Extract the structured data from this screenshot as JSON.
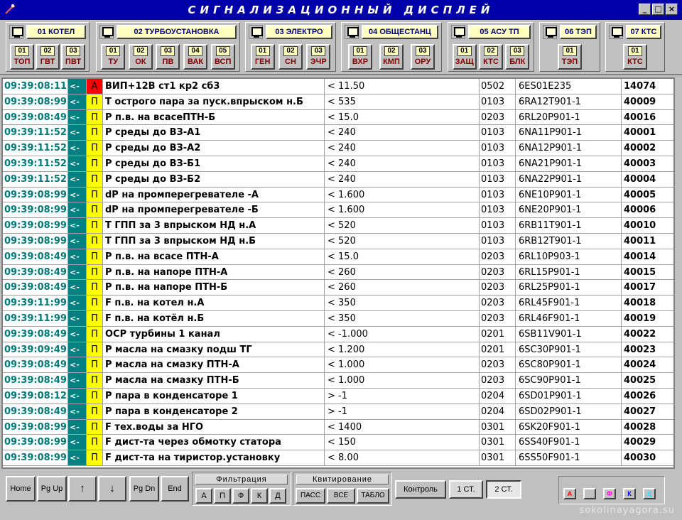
{
  "window": {
    "title": "СИГНАЛИЗАЦИОННЫЙ   ДИСПЛЕЙ",
    "min": "_",
    "max": "□",
    "close": "×"
  },
  "groups": [
    {
      "title": "01 КОТЕЛ",
      "buttons": [
        {
          "num": "01",
          "code": "ТОП"
        },
        {
          "num": "02",
          "code": "ГВТ"
        },
        {
          "num": "03",
          "code": "ПВТ"
        }
      ]
    },
    {
      "title": "02 ТУРБОУСТАНОВКА",
      "buttons": [
        {
          "num": "01",
          "code": "ТУ"
        },
        {
          "num": "02",
          "code": "ОК"
        },
        {
          "num": "03",
          "code": "ПВ"
        },
        {
          "num": "04",
          "code": "ВАК"
        },
        {
          "num": "05",
          "code": "ВСП"
        }
      ]
    },
    {
      "title": "03 ЭЛЕКТРО",
      "buttons": [
        {
          "num": "01",
          "code": "ГЕН"
        },
        {
          "num": "02",
          "code": "СН"
        },
        {
          "num": "03",
          "code": "ЭЧР"
        }
      ]
    },
    {
      "title": "04 ОБЩЕСТАНЦ",
      "buttons": [
        {
          "num": "01",
          "code": "ВХР"
        },
        {
          "num": "02",
          "code": "КМП"
        },
        {
          "num": "03",
          "code": "ОРУ"
        }
      ]
    },
    {
      "title": "05 АСУ ТП",
      "buttons": [
        {
          "num": "01",
          "code": "ЗАЩ"
        },
        {
          "num": "02",
          "code": "КТС"
        },
        {
          "num": "03",
          "code": "БЛК"
        }
      ]
    },
    {
      "title": "06 ТЭП",
      "buttons": [
        {
          "num": "01",
          "code": "ТЭП"
        }
      ]
    },
    {
      "title": "07 КТС",
      "buttons": [
        {
          "num": "01",
          "code": "КТС"
        }
      ]
    }
  ],
  "rows": [
    {
      "time": "09:39:08:11",
      "dir": "<-",
      "type": "А",
      "alarm": true,
      "name": "ВИП+12В ст1 кр2 сб3",
      "value": "<  11.50",
      "code": "0502",
      "kks": "6ES01E235",
      "id": "14074"
    },
    {
      "time": "09:39:08:99",
      "dir": "<-",
      "type": "П",
      "name": "Т острого пара за пуск.впрыском н.Б",
      "value": "<  535",
      "code": "0103",
      "kks": "6RA12T901-1",
      "id": "40009"
    },
    {
      "time": "09:39:08:49",
      "dir": "<-",
      "type": "П",
      "name": "Р п.в. на всасеПТН-Б",
      "value": "<  15.0",
      "code": "0203",
      "kks": "6RL20P901-1",
      "id": "40016"
    },
    {
      "time": "09:39:11:52",
      "dir": "<-",
      "type": "П",
      "name": "Р среды до ВЗ-А1",
      "value": "<  240",
      "code": "0103",
      "kks": "6NA11P901-1",
      "id": "40001"
    },
    {
      "time": "09:39:11:52",
      "dir": "<-",
      "type": "П",
      "name": "Р среды до ВЗ-А2",
      "value": "<  240",
      "code": "0103",
      "kks": "6NA12P901-1",
      "id": "40002"
    },
    {
      "time": "09:39:11:52",
      "dir": "<-",
      "type": "П",
      "name": "Р среды до ВЗ-Б1",
      "value": "<  240",
      "code": "0103",
      "kks": "6NA21P901-1",
      "id": "40003"
    },
    {
      "time": "09:39:11:52",
      "dir": "<-",
      "type": "П",
      "name": "Р среды до ВЗ-Б2",
      "value": "<  240",
      "code": "0103",
      "kks": "6NA22P901-1",
      "id": "40004"
    },
    {
      "time": "09:39:08:99",
      "dir": "<-",
      "type": "П",
      "name": "dP на промперегревателе -А",
      "value": "<  1.600",
      "code": "0103",
      "kks": "6NE10P901-1",
      "id": "40005"
    },
    {
      "time": "09:39:08:99",
      "dir": "<-",
      "type": "П",
      "name": "dP на промперегревателе -Б",
      "value": "<  1.600",
      "code": "0103",
      "kks": "6NE20P901-1",
      "id": "40006"
    },
    {
      "time": "09:39:08:99",
      "dir": "<-",
      "type": "П",
      "name": "Т ГПП за 3 впрыском НД н.А",
      "value": "<  520",
      "code": "0103",
      "kks": "6RB11T901-1",
      "id": "40010"
    },
    {
      "time": "09:39:08:99",
      "dir": "<-",
      "type": "П",
      "name": "Т ГПП за 3 впрыском НД н.Б",
      "value": "<  520",
      "code": "0103",
      "kks": "6RB12T901-1",
      "id": "40011"
    },
    {
      "time": "09:39:08:49",
      "dir": "<-",
      "type": "П",
      "name": "Р п.в. на всасе ПТН-А",
      "value": "<  15.0",
      "code": "0203",
      "kks": "6RL10P903-1",
      "id": "40014"
    },
    {
      "time": "09:39:08:49",
      "dir": "<-",
      "type": "П",
      "name": "Р п.в. на напоре ПТН-А",
      "value": "<  260",
      "code": "0203",
      "kks": "6RL15P901-1",
      "id": "40015"
    },
    {
      "time": "09:39:08:49",
      "dir": "<-",
      "type": "П",
      "name": "Р п.в. на напоре  ПТН-Б",
      "value": "<  260",
      "code": "0203",
      "kks": "6RL25P901-1",
      "id": "40017"
    },
    {
      "time": "09:39:11:99",
      "dir": "<-",
      "type": "П",
      "name": "F п.в. на котел н.А",
      "value": "<   350",
      "code": "0203",
      "kks": "6RL45F901-1",
      "id": "40018"
    },
    {
      "time": "09:39:11:99",
      "dir": "<-",
      "type": "П",
      "name": "F п.в. на котёл н.Б",
      "value": "<   350",
      "code": "0203",
      "kks": "6RL46F901-1",
      "id": "40019"
    },
    {
      "time": "09:39:08:49",
      "dir": "<-",
      "type": "П",
      "name": "ОСР турбины 1 канал",
      "value": "< -1.000",
      "code": "0201",
      "kks": "6SB11V901-1",
      "id": "40022"
    },
    {
      "time": "09:39:09:49",
      "dir": "<-",
      "type": "П",
      "name": "Р масла на смазку подш ТГ",
      "value": "<  1.200",
      "code": "0201",
      "kks": "6SC30P901-1",
      "id": "40023"
    },
    {
      "time": "09:39:08:49",
      "dir": "<-",
      "type": "П",
      "name": "Р масла на смазку ПТН-А",
      "value": "<  1.000",
      "code": "0203",
      "kks": "6SC80P901-1",
      "id": "40024"
    },
    {
      "time": "09:39:08:49",
      "dir": "<-",
      "type": "П",
      "name": "Р масла на смазку ПТН-Б",
      "value": "<  1.000",
      "code": "0203",
      "kks": "6SC90P901-1",
      "id": "40025"
    },
    {
      "time": "09:39:08:12",
      "dir": "<-",
      "type": "П",
      "name": "Р пара в конденсаторе 1",
      "value": ">     -1",
      "code": "0204",
      "kks": "6SD01P901-1",
      "id": "40026"
    },
    {
      "time": "09:39:08:49",
      "dir": "<-",
      "type": "П",
      "name": "Р пара в конденсаторе 2",
      "value": ">     -1",
      "code": "0204",
      "kks": "6SD02P901-1",
      "id": "40027"
    },
    {
      "time": "09:39:08:99",
      "dir": "<-",
      "type": "П",
      "name": "F тех.воды за НГО",
      "value": "<  1400",
      "code": "0301",
      "kks": "6SK20F901-1",
      "id": "40028"
    },
    {
      "time": "09:39:08:99",
      "dir": "<-",
      "type": "П",
      "name": "F дист-та через обмотку статора",
      "value": "<  150",
      "code": "0301",
      "kks": "6SS40F901-1",
      "id": "40029"
    },
    {
      "time": "09:39:08:99",
      "dir": "<-",
      "type": "П",
      "name": "F дист-та на тиристор.установку",
      "value": "<   8.00",
      "code": "0301",
      "kks": "6SS50F901-1",
      "id": "40030"
    }
  ],
  "bottom": {
    "nav": [
      "Home",
      "Pg Up",
      "↑",
      "↓",
      "Pg Dn",
      "End"
    ],
    "filter_title": "Фильтрация",
    "filter": [
      "А",
      "П",
      "Ф",
      "К",
      "Д"
    ],
    "ack_title": "Квитирование",
    "ack": [
      "ПАСС",
      "ВСЕ",
      "ТАБЛО"
    ],
    "control": "Контроль",
    "stations": [
      "1 СТ.",
      "2 СТ."
    ],
    "legend": [
      "А",
      "",
      "Ф",
      "К",
      "Д"
    ]
  },
  "colors": {
    "legend": [
      "#ff0000",
      "#ffff00",
      "#ff00ff",
      "#0000ff",
      "#00ffff"
    ]
  },
  "watermark": "sokolinayagora.su"
}
